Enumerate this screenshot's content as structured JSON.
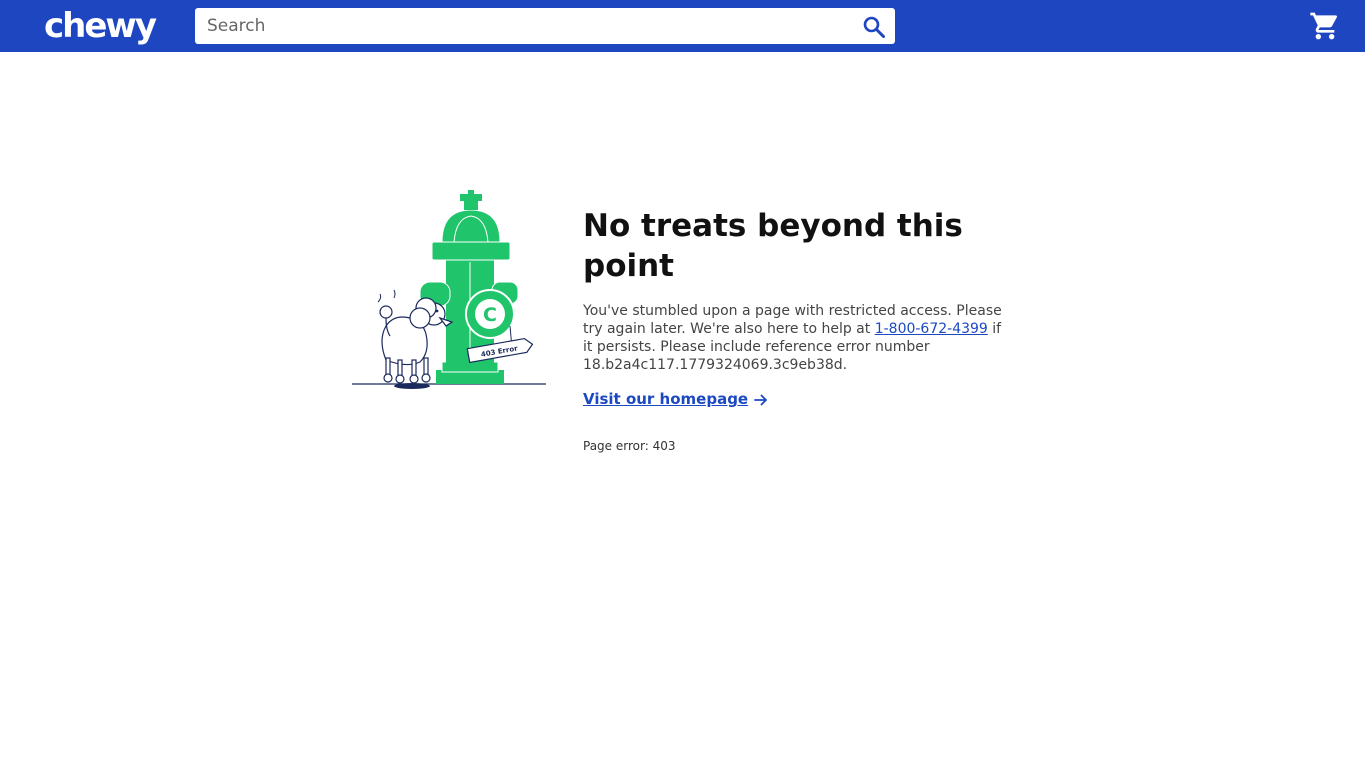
{
  "header": {
    "logo_text": "chewy",
    "search": {
      "placeholder": "Search",
      "value": ""
    },
    "search_icon": "search-icon",
    "cart_icon": "cart-icon"
  },
  "error": {
    "title": "No treats beyond this point",
    "message_part1": "You've stumbled upon a page with restricted access. Please try again later. We're also here to help at ",
    "phone": "1-800-672-4399",
    "message_part2": " if it persists. Please include reference error number 18.b2a4c117.1779324069.3c9eb38d.",
    "home_link_label": "Visit our homepage",
    "page_error_text": "Page error: 403",
    "illustration_sign_text": "403 Error",
    "illustration_hydrant_letter": "C"
  },
  "colors": {
    "brand_blue": "#1f46c1",
    "link_blue": "#1c49c2",
    "hydrant_green": "#1fc46b",
    "text_dark": "#111111"
  }
}
